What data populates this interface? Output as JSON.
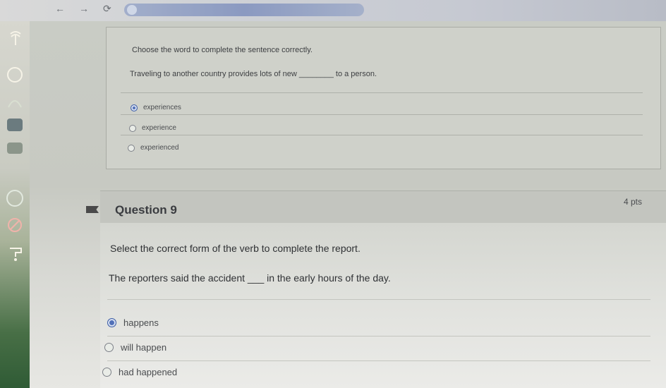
{
  "browser": {
    "back_glyph": "←",
    "forward_glyph": "→",
    "reload_glyph": "⟳"
  },
  "sidebar": {
    "items": [
      {
        "icon": "account-icon"
      },
      {
        "icon": "dashboard-icon"
      },
      {
        "icon": "courses-icon"
      },
      {
        "icon": "calendar-icon"
      },
      {
        "icon": "inbox-icon"
      },
      {
        "icon": "history-icon"
      },
      {
        "icon": "help-icon"
      }
    ]
  },
  "question8": {
    "prompt": "Choose the word to complete the sentence correctly.",
    "sentence_before": "Traveling to another country provides lots of new",
    "blank": "________",
    "sentence_after": "to a person.",
    "options": [
      {
        "label": "experiences",
        "selected": true
      },
      {
        "label": "experience",
        "selected": false
      },
      {
        "label": "experienced",
        "selected": false
      }
    ]
  },
  "question9": {
    "title": "Question 9",
    "points": "4 pts",
    "prompt": "Select the correct form of the verb to complete the report.",
    "sentence": "The reporters said the accident ___ in the early hours of the day.",
    "options": [
      {
        "label": "happens",
        "selected": true
      },
      {
        "label": "will happen",
        "selected": false
      },
      {
        "label": "had happened",
        "selected": false
      }
    ]
  },
  "colors": {
    "selected_radio": "#5170b8",
    "rail_green": "#2f5b35"
  }
}
